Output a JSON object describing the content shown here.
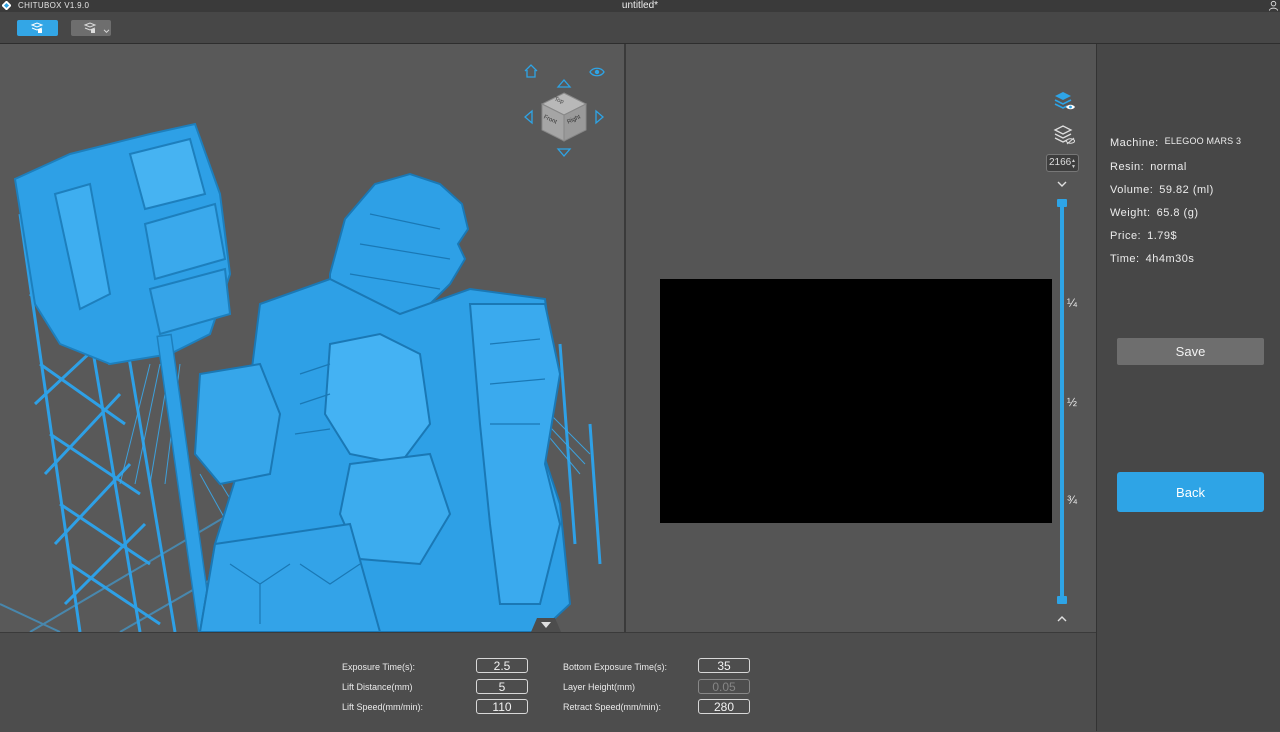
{
  "titlebar": {
    "app_name": "CHITUBOX V1.9.0",
    "document_title": "untitled*"
  },
  "toolbar": {
    "buttons": [
      {
        "icon": "slice-mode-icon",
        "active": true
      },
      {
        "icon": "layer-mode-icon",
        "active": false
      }
    ]
  },
  "nav_cube": {
    "faces": {
      "top": "Top",
      "front": "Front",
      "right": "Right"
    }
  },
  "slice_preview": {
    "current_layer": "2166",
    "ticks": [
      "¼",
      "½",
      "¾"
    ],
    "accent": "#2ea4e6"
  },
  "info": {
    "machine_label": "Machine:",
    "machine_value": "ELEGOO MARS 3",
    "resin_label": "Resin:",
    "resin_value": "normal",
    "volume_label": "Volume:",
    "volume_value": "59.82 (ml)",
    "weight_label": "Weight:",
    "weight_value": "65.8 (g)",
    "price_label": "Price:",
    "price_value": "1.79$",
    "time_label": "Time:",
    "time_value": "4h4m30s",
    "save_label": "Save",
    "back_label": "Back"
  },
  "params": {
    "exposure_time": {
      "label": "Exposure Time(s):",
      "value": "2.5"
    },
    "lift_distance": {
      "label": "Lift Distance(mm)",
      "value": "5"
    },
    "lift_speed": {
      "label": "Lift Speed(mm/min):",
      "value": "110"
    },
    "bottom_exposure_time": {
      "label": "Bottom Exposure Time(s):",
      "value": "35"
    },
    "layer_height": {
      "label": "Layer Height(mm)",
      "value": "0.05"
    },
    "retract_speed": {
      "label": "Retract Speed(mm/min):",
      "value": "280"
    }
  },
  "colors": {
    "model": "#2ea0e6",
    "viewport": "#595959",
    "panel": "#474747"
  }
}
